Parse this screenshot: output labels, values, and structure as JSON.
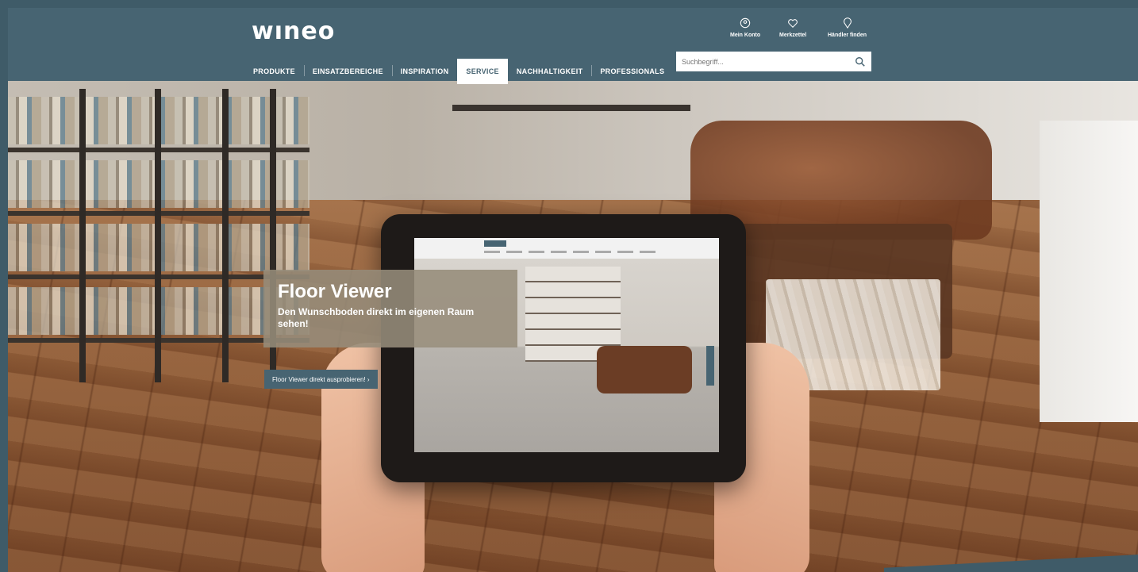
{
  "header": {
    "logo": "wıneo",
    "nav": [
      "PRODUKTE",
      "EINSATZBEREICHE",
      "INSPIRATION",
      "SERVICE",
      "NACHHALTIGKEIT",
      "PROFESSIONALS"
    ],
    "active_nav": "SERVICE",
    "utility": [
      {
        "label": "Mein Konto",
        "icon": "user-icon"
      },
      {
        "label": "Merkzettel",
        "icon": "heart-icon"
      },
      {
        "label": "Händler finden",
        "icon": "location-icon"
      }
    ],
    "search": {
      "placeholder": "Suchbegriff..."
    }
  },
  "hero": {
    "title": "Floor Viewer",
    "subtitle": "Den Wunschboden direkt im eigenen Raum sehen!",
    "cta": "Floor Viewer direkt ausprobieren! ›"
  },
  "colors": {
    "header_bg": "#476472",
    "accent": "#476472",
    "promo_bg": "#968c7a"
  }
}
